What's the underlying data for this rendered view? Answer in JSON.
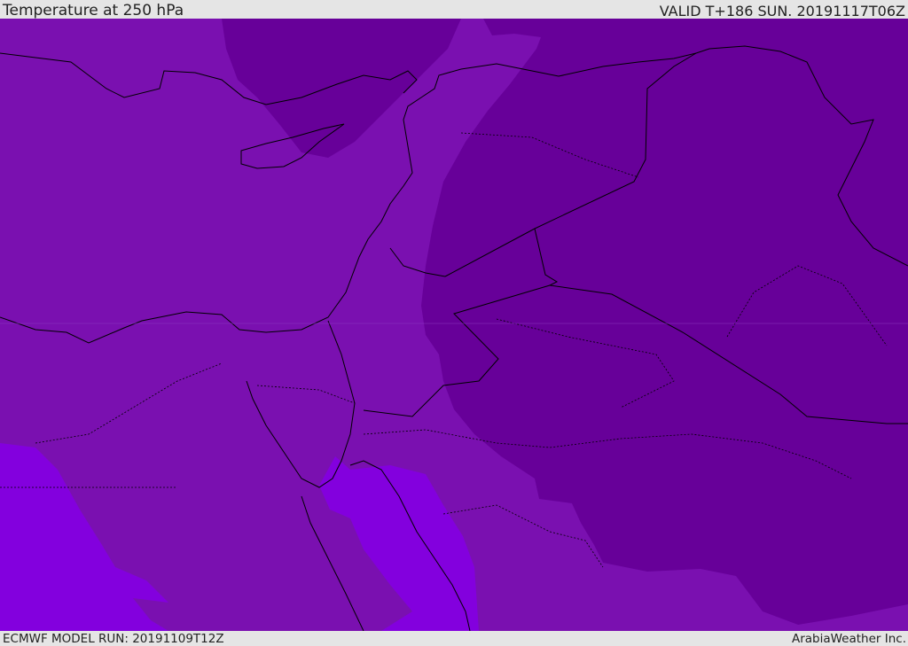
{
  "header": {
    "title": "Temperature at 250 hPa",
    "valid": "VALID T+186 SUN. 20191117T06Z"
  },
  "footer": {
    "model_run": "ECMWF MODEL RUN: 20191109T12Z",
    "brand": "ArabiaWeather Inc."
  },
  "colors": {
    "mid": "#7a10b0",
    "dark": "#670099",
    "bright": "#8300de",
    "coast": "#000000"
  }
}
